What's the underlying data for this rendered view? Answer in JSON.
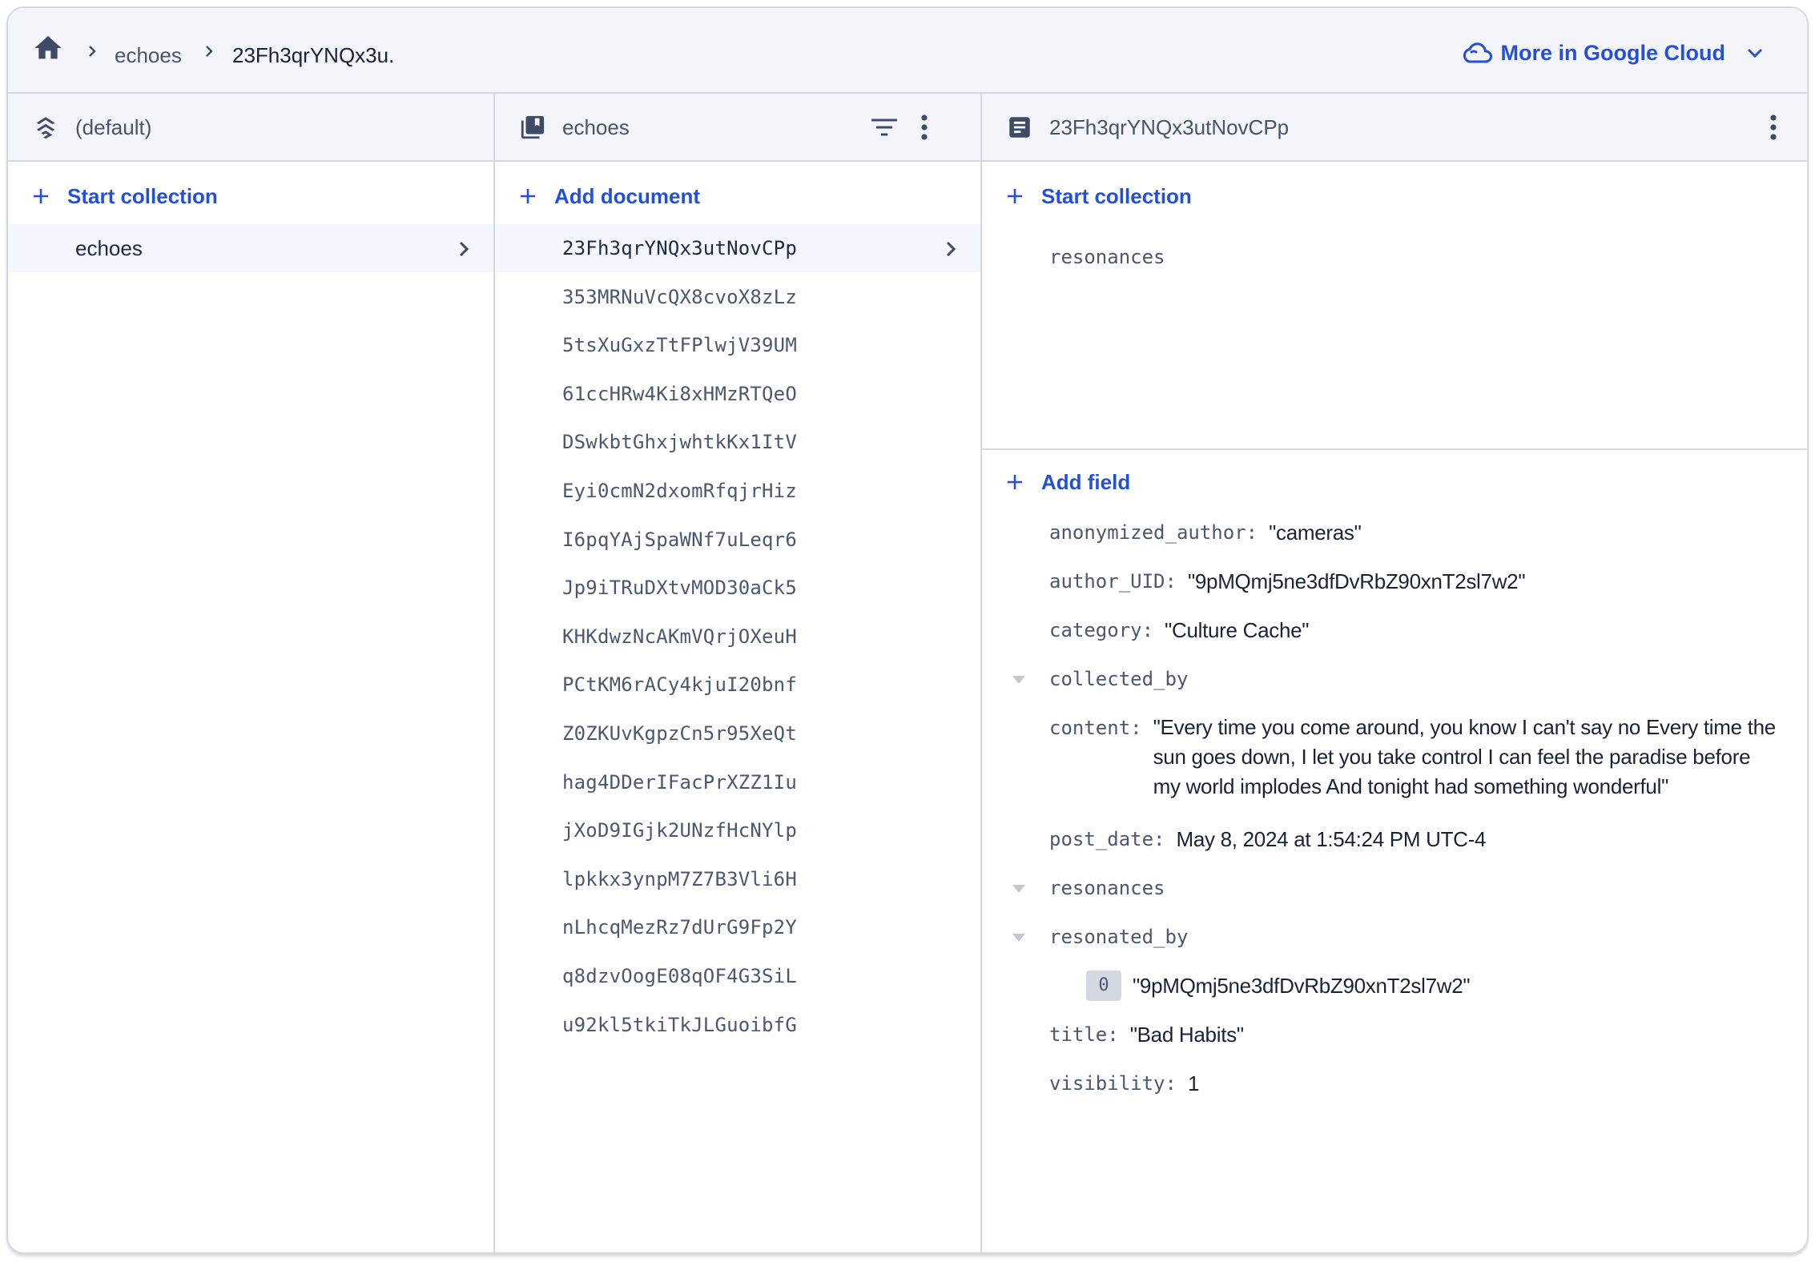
{
  "topbar": {
    "breadcrumb": [
      {
        "label": "echoes"
      },
      {
        "label": "23Fh3qrYNQx3u."
      }
    ],
    "cloud_button": "More in Google Cloud"
  },
  "columns": {
    "database": {
      "title": "(default)",
      "add_label": "Start collection",
      "items": [
        {
          "label": "echoes",
          "selected": true
        }
      ]
    },
    "collection": {
      "title": "echoes",
      "add_label": "Add document",
      "documents": [
        "23Fh3qrYNQx3utNovCPp",
        "353MRNuVcQX8cvoX8zLz",
        "5tsXuGxzTtFPlwjV39UM",
        "61ccHRw4Ki8xHMzRTQeO",
        "DSwkbtGhxjwhtkKx1ItV",
        "Eyi0cmN2dxomRfqjrHiz",
        "I6pqYAjSpaWNf7uLeqr6",
        "Jp9iTRuDXtvMOD30aCk5",
        "KHKdwzNcAKmVQrjOXeuH",
        "PCtKM6rACy4kjuI20bnf",
        "Z0ZKUvKgpzCn5r95XeQt",
        "hag4DDerIFacPrXZZ1Iu",
        "jXoD9IGjk2UNzfHcNYlp",
        "lpkkx3ynpM7Z7B3Vli6H",
        "nLhcqMezRz7dUrG9Fp2Y",
        "q8dzvOogE08qOF4G3SiL",
        "u92kl5tkiTkJLGuoibfG"
      ],
      "selected_index": 0
    },
    "document": {
      "title": "23Fh3qrYNQx3utNovCPp",
      "add_collection_label": "Start collection",
      "subcollections": [
        "resonances"
      ],
      "add_field_label": "Add field",
      "fields": {
        "anonymized_author": {
          "key": "anonymized_author:",
          "value": "\"cameras\""
        },
        "author_UID": {
          "key": "author_UID:",
          "value": "\"9pMQmj5ne3dfDvRbZ90xnT2sl7w2\""
        },
        "category": {
          "key": "category:",
          "value": "\"Culture Cache\""
        },
        "collected_by": {
          "key": "collected_by"
        },
        "content": {
          "key": "content:",
          "value": "\"Every time you come around, you know I can't say no Every time the sun goes down, I let you take control I can feel the paradise before my world implodes And tonight had something wonderful\""
        },
        "post_date": {
          "key": "post_date:",
          "value": "May 8, 2024 at 1:54:24 PM UTC-4"
        },
        "resonances": {
          "key": "resonances"
        },
        "resonated_by": {
          "key": "resonated_by",
          "items": [
            {
              "index": "0",
              "value": "\"9pMQmj5ne3dfDvRbZ90xnT2sl7w2\""
            }
          ]
        },
        "title": {
          "key": "title:",
          "value": "\"Bad Habits\""
        },
        "visibility": {
          "key": "visibility:",
          "value": "1"
        }
      }
    }
  },
  "colors": {
    "accent": "#2450d8",
    "header_bg": "#f4f5fb",
    "selected_row_bg": "#f4f7fd",
    "border": "#d6d9e3",
    "icon": "#3f4a66"
  }
}
